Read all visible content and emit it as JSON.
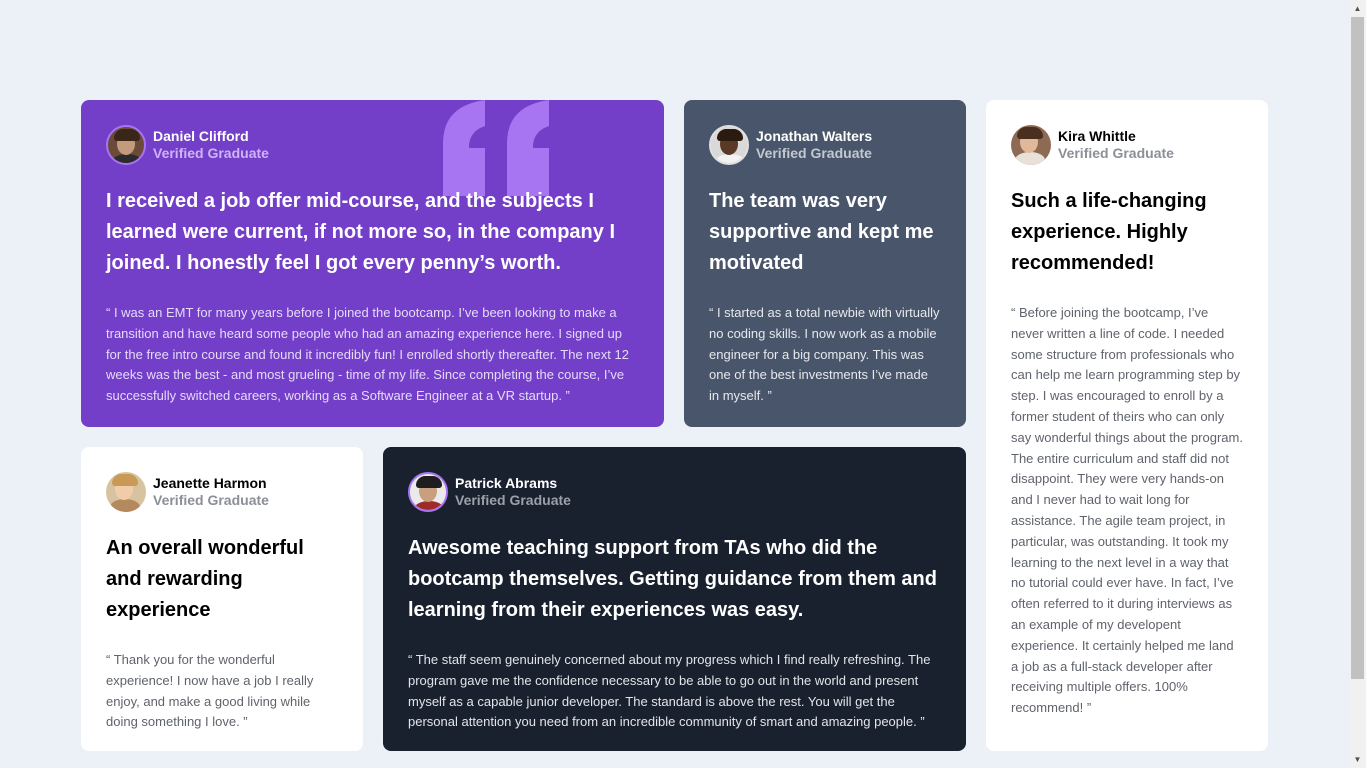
{
  "testimonials": [
    {
      "name": "Daniel Clifford",
      "role": "Verified Graduate",
      "headline": "I received a job offer mid-course, and the subjects I learned were current, if not more so, in the company I joined. I honestly feel I got every penny’s worth.",
      "quote": "“ I was an EMT for many years before I joined the bootcamp. I’ve been looking to make a transition and have heard some people who had an amazing experience here. I signed up for the free intro course and found it incredibly fun! I enrolled shortly thereafter. The next 12 weeks was the best - and most grueling - time of my life. Since completing the course, I’ve successfully switched careers, working as a Software Engineer at a VR startup. ”"
    },
    {
      "name": "Jonathan Walters",
      "role": "Verified Graduate",
      "headline": "The team was very supportive and kept me motivated",
      "quote": "“ I started as a total newbie with virtually no coding skills. I now work as a mobile engineer for a big company. This was one of the best investments I’ve made in myself. ”"
    },
    {
      "name": "Kira Whittle",
      "role": "Verified Graduate",
      "headline": "Such a life-changing experience. Highly recommended!",
      "quote": "“ Before joining the bootcamp, I’ve never written a line of code. I needed some structure from professionals who can help me learn programming step by step. I was encouraged to enroll by a former student of theirs who can only say wonderful things about the program. The entire curriculum and staff did not disappoint. They were very hands-on and I never had to wait long for assistance. The agile team project, in particular, was outstanding. It took my learning to the next level in a way that no tutorial could ever have. In fact, I’ve often referred to it during interviews as an example of my developent experience. It certainly helped me land a job as a full-stack developer after receiving multiple offers. 100% recommend! ”"
    },
    {
      "name": "Jeanette Harmon",
      "role": "Verified Graduate",
      "headline": "An overall wonderful and rewarding experience",
      "quote": "“ Thank you for the wonderful experience! I now have a job I really enjoy, and make a good living while doing something I love. ”"
    },
    {
      "name": "Patrick Abrams",
      "role": "Verified Graduate",
      "headline": "Awesome teaching support from TAs who did the bootcamp themselves. Getting guidance from them and learning from their experiences was easy.",
      "quote": "“ The staff seem genuinely concerned about my progress which I find really refreshing. The program gave me the confidence necessary to be able to go out in the world and present myself as a capable junior developer. The standard is above the rest. You will get the personal attention you need from an incredible community of smart and amazing people. ”"
    }
  ],
  "colors": {
    "background": "#ecf1f8",
    "purple": "#733fc8",
    "slate": "#48556a",
    "dark": "#19212e",
    "white": "#ffffff",
    "quote_mark": "#a775f1"
  }
}
